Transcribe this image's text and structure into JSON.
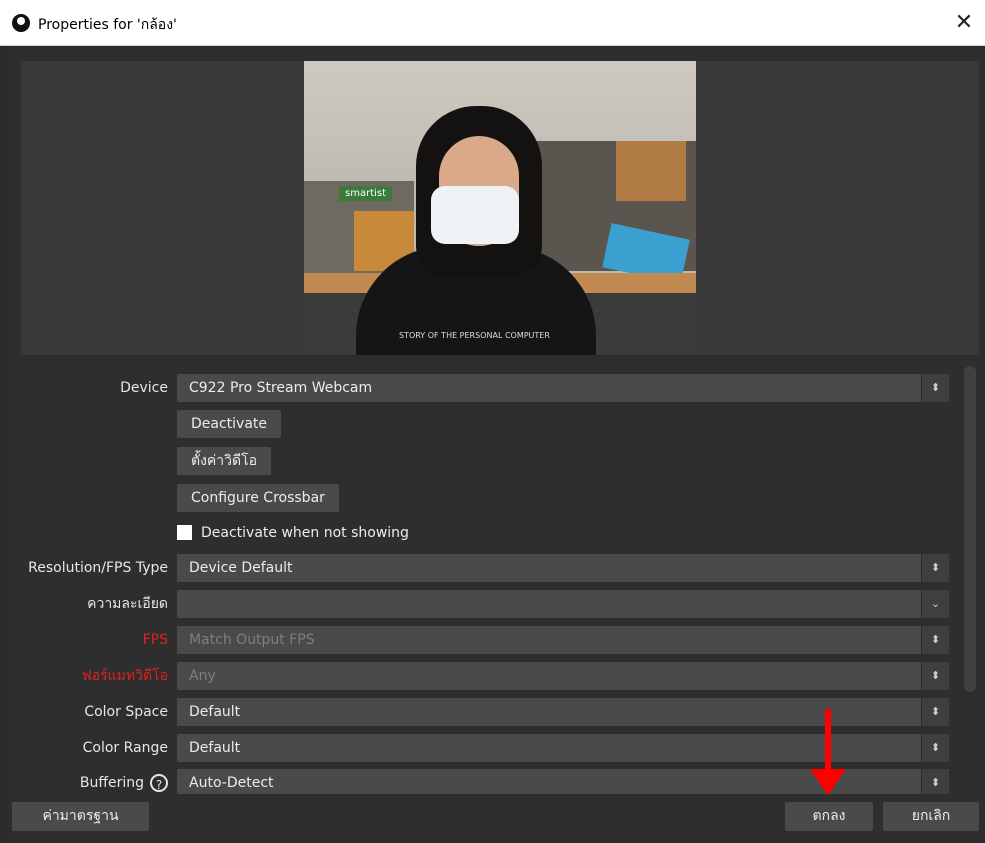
{
  "window": {
    "title": "Properties for 'กล้อง'",
    "close_glyph": "✕"
  },
  "preview": {
    "shirt_text": "STORY OF THE PERSONAL COMPUTER",
    "sign_text": "smartist"
  },
  "form": {
    "device": {
      "label": "Device",
      "value": "C922 Pro Stream Webcam"
    },
    "deactivate_button": "Deactivate",
    "video_settings_button": "ตั้งค่าวิดีโอ",
    "configure_crossbar_button": "Configure Crossbar",
    "deactivate_when_not_showing": {
      "label": "Deactivate when not showing",
      "checked": false
    },
    "resolution_fps_type": {
      "label": "Resolution/FPS Type",
      "value": "Device Default"
    },
    "resolution": {
      "label": "ความละเอียด",
      "value": ""
    },
    "fps": {
      "label": "FPS",
      "value": "Match Output FPS"
    },
    "video_format": {
      "label": "ฟอร์แมทวิดีโอ",
      "value": "Any"
    },
    "color_space": {
      "label": "Color Space",
      "value": "Default"
    },
    "color_range": {
      "label": "Color Range",
      "value": "Default"
    },
    "buffering": {
      "label": "Buffering",
      "value": "Auto-Detect",
      "help_glyph": "?"
    }
  },
  "buttons": {
    "defaults": "ค่ามาตรฐาน",
    "ok": "ตกลง",
    "cancel": "ยกเลิก"
  },
  "icons": {
    "spin": "⬍",
    "dropdown": "⌄"
  },
  "colors": {
    "warning_label": "#e02020",
    "annotation_arrow": "#ff0000"
  }
}
